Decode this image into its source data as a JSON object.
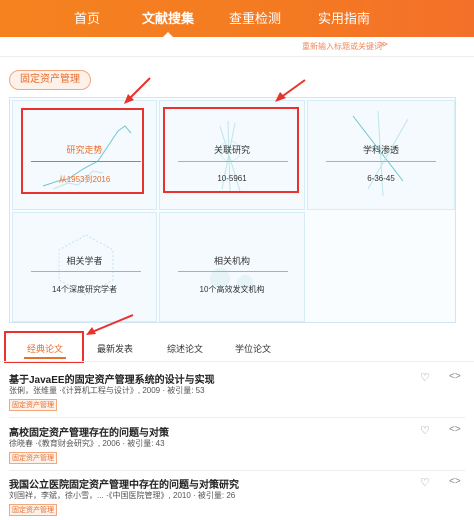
{
  "nav": {
    "items": [
      "首页",
      "文献搜集",
      "查重检测",
      "实用指南"
    ],
    "active_index": 1
  },
  "hint": {
    "text": "重新输入标题或关键词",
    "icon": "chevron-down-icon"
  },
  "topic_tag": "固定资产管理",
  "cards": [
    {
      "title": "研究走势",
      "sub": "从1953到2016"
    },
    {
      "title": "关联研究",
      "sub": "10-5961"
    },
    {
      "title": "学科渗透",
      "sub": "6-36-45"
    },
    {
      "title": "相关学者",
      "sub": "14个深度研究学者"
    },
    {
      "title": "相关机构",
      "sub": "10个高效发文机构"
    }
  ],
  "tabs": [
    "经典论文",
    "最新发表",
    "综述论文",
    "学位论文"
  ],
  "active_tab": 0,
  "articles": [
    {
      "title": "基于JavaEE的固定资产管理系统的设计与实现",
      "meta": "张俐，张维量 ·《计算机工程与设计》, 2009 · 被引量: 53",
      "tag": "固定资产管理"
    },
    {
      "title": "高校固定资产管理存在的问题与对策",
      "meta": "徐晓春 ·《教育财会研究》, 2006 · 被引量: 43",
      "tag": "固定资产管理"
    },
    {
      "title": "我国公立医院固定资产管理中存在的问题与对策研究",
      "meta": "刘国祥，李斌，徐小雪，... ·《中国医院管理》, 2010 · 被引量: 26",
      "tag": "固定资产管理"
    }
  ],
  "icons": {
    "favorite": "heart-icon",
    "share": "share-icon"
  },
  "colors": {
    "brand": "#f47a22",
    "highlight": "#e8322b",
    "teal": "#6fc7cf"
  }
}
